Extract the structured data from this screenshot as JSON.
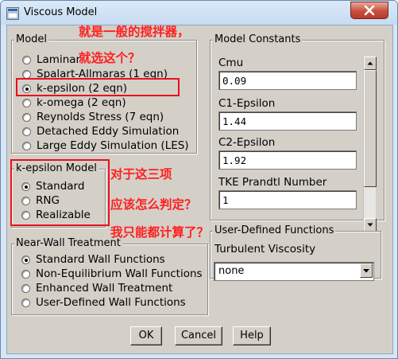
{
  "window": {
    "title": "Viscous Model",
    "close_icon": "close-icon"
  },
  "model": {
    "label": "Model",
    "options": [
      {
        "label": "Laminar",
        "selected": false
      },
      {
        "label": "Spalart-Allmaras  (1 eqn)",
        "selected": false
      },
      {
        "label": "k-epsilon  (2 eqn)",
        "selected": true
      },
      {
        "label": "k-omega  (2 eqn)",
        "selected": false
      },
      {
        "label": "Reynolds Stress  (7 eqn)",
        "selected": false
      },
      {
        "label": "Detached Eddy Simulation",
        "selected": false
      },
      {
        "label": "Large Eddy Simulation (LES)",
        "selected": false
      }
    ]
  },
  "kepsilon_model": {
    "label": "k-epsilon Model",
    "options": [
      {
        "label": "Standard",
        "selected": true
      },
      {
        "label": "RNG",
        "selected": false
      },
      {
        "label": "Realizable",
        "selected": false
      }
    ]
  },
  "near_wall": {
    "label": "Near-Wall Treatment",
    "options": [
      {
        "label": "Standard Wall Functions",
        "selected": true
      },
      {
        "label": "Non-Equilibrium Wall Functions",
        "selected": false
      },
      {
        "label": "Enhanced Wall Treatment",
        "selected": false
      },
      {
        "label": "User-Defined Wall Functions",
        "selected": false
      }
    ]
  },
  "constants": {
    "label": "Model Constants",
    "items": [
      {
        "label": "Cmu",
        "value": "0.09"
      },
      {
        "label": "C1-Epsilon",
        "value": "1.44"
      },
      {
        "label": "C2-Epsilon",
        "value": "1.92"
      },
      {
        "label": "TKE Prandtl Number",
        "value": "1"
      }
    ]
  },
  "udf": {
    "label": "User-Defined Functions",
    "viscosity_label": "Turbulent Viscosity",
    "viscosity_value": "none"
  },
  "buttons": {
    "ok": "OK",
    "cancel": "Cancel",
    "help": "Help"
  },
  "annotations": {
    "line1": "就是一般的搅拌器，",
    "line2": "就选这个？",
    "line3": "对于这三项",
    "line4": "应该怎么判定？",
    "line5": "我只能都计算了？",
    "color": "#ff1f1f"
  }
}
